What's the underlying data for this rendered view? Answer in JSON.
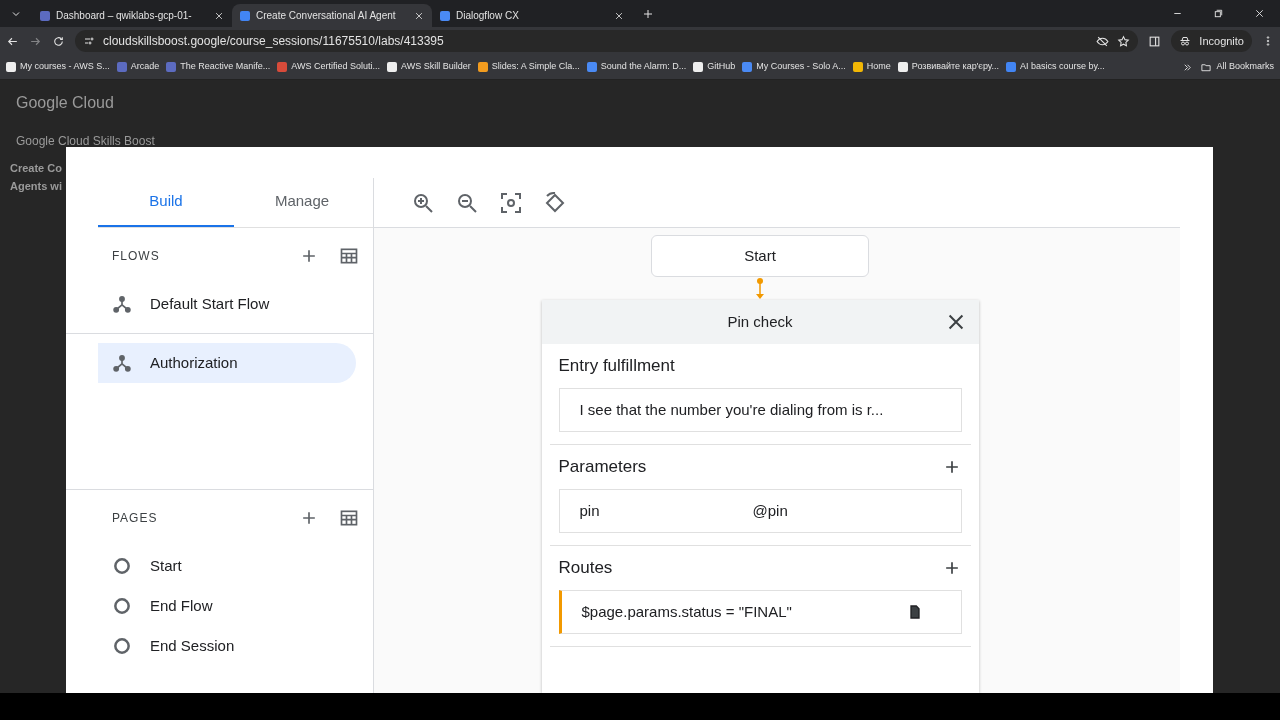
{
  "browser": {
    "tabs": [
      {
        "title": "Dashboard – qwiklabs-gcp-01-",
        "selected": false
      },
      {
        "title": "Create Conversational AI Agent",
        "selected": true
      },
      {
        "title": "Dialogflow CX",
        "selected": false
      }
    ],
    "url": "cloudskillsboost.google/course_sessions/11675510/labs/413395",
    "profile": "Incognito",
    "bookmarks": [
      {
        "title": "My courses - AWS S...",
        "color": "#eeeeee"
      },
      {
        "title": "Arcade",
        "color": "#5c6bc0"
      },
      {
        "title": "The Reactive Manife...",
        "color": "#5c6bc0"
      },
      {
        "title": "AWS Certified Soluti...",
        "color": "#d84b3a"
      },
      {
        "title": "AWS Skill Builder",
        "color": "#eeeeee"
      },
      {
        "title": "Slides: A Simple Cla...",
        "color": "#f29c1f"
      },
      {
        "title": "Sound the Alarm: D...",
        "color": "#4a8af4"
      },
      {
        "title": "GitHub",
        "color": "#eeeeee"
      },
      {
        "title": "My Courses - Solo A...",
        "color": "#4a8af4"
      },
      {
        "title": "Home",
        "color": "#f2b705"
      },
      {
        "title": "Розвивайте кар'єру...",
        "color": "#eeeeee"
      },
      {
        "title": "AI basics course by...",
        "color": "#4285f4"
      }
    ],
    "all_bookmarks": "All Bookmarks"
  },
  "backdrop": {
    "brand": "Google Cloud",
    "title": "Google Cloud Skills Boost",
    "course_title": [
      "Create Co",
      "Agents wi"
    ]
  },
  "editor": {
    "tabs": [
      {
        "label": "Build",
        "selected": true
      },
      {
        "label": "Manage",
        "selected": false
      }
    ],
    "flows": {
      "label": "FLOWS",
      "items": [
        {
          "name": "Default Start Flow",
          "selected": false
        },
        {
          "name": "Authorization",
          "selected": true
        }
      ]
    },
    "pages": {
      "label": "PAGES",
      "items": [
        {
          "name": "Start",
          "selected": false
        },
        {
          "name": "End Flow",
          "selected": false
        },
        {
          "name": "End Session",
          "selected": false
        }
      ]
    },
    "start_node": "Start",
    "page_card": {
      "title": "Pin check",
      "entry_fulfillment": {
        "heading": "Entry fulfillment",
        "text": "I see that the number you're dialing from is r..."
      },
      "parameters": {
        "heading": "Parameters",
        "items": [
          {
            "name": "pin",
            "entity": "@pin"
          }
        ]
      },
      "routes": {
        "heading": "Routes",
        "items": [
          {
            "condition": "$page.params.status = \"FINAL\""
          }
        ]
      }
    }
  }
}
